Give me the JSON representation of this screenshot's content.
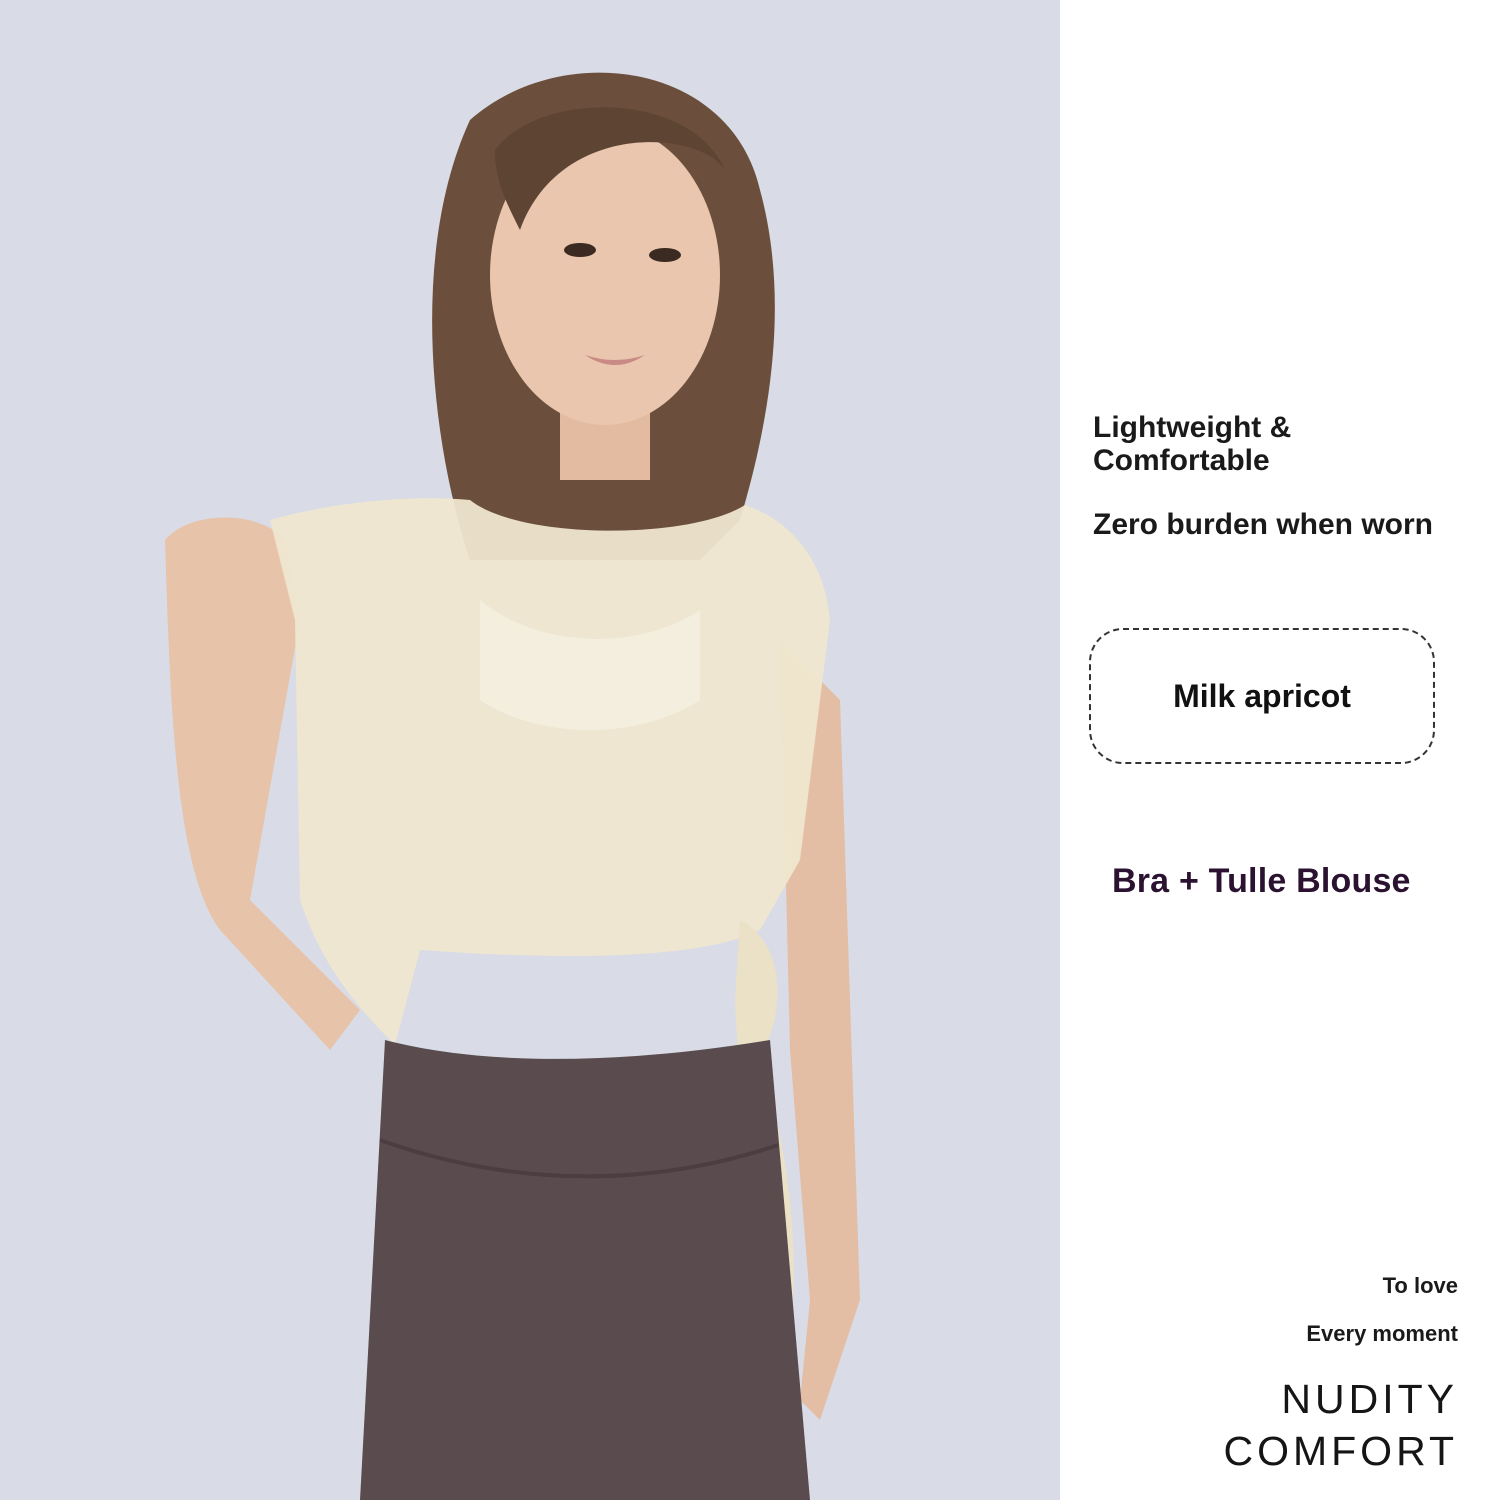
{
  "product": {
    "features": [
      "Lightweight & Comfortable",
      "Zero burden when worn"
    ],
    "color_name": "Milk apricot",
    "set_label": "Bra + Tulle Blouse"
  },
  "slogan": {
    "line1": "To love",
    "line2": "Every moment"
  },
  "brand": {
    "line1": "NUDITY",
    "line2": "COMFORT"
  },
  "colors": {
    "photo_background": "#d9dce6",
    "top_fabric": "#efe6cf",
    "leggings": "#5a4b4f",
    "hair": "#6b4f3c",
    "skin": "#e7c3aa",
    "set_label_text": "#2a1230"
  }
}
